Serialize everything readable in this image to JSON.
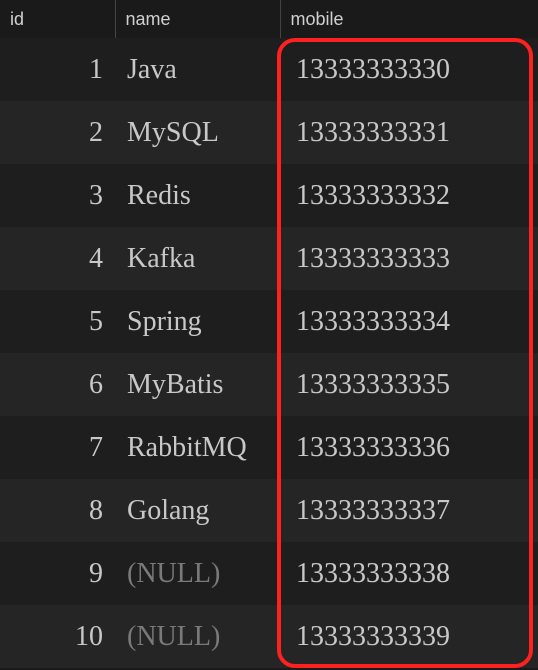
{
  "chart_data": {
    "type": "table",
    "columns": [
      "id",
      "name",
      "mobile"
    ],
    "rows": [
      {
        "id": 1,
        "name": "Java",
        "mobile": "13333333330"
      },
      {
        "id": 2,
        "name": "MySQL",
        "mobile": "13333333331"
      },
      {
        "id": 3,
        "name": "Redis",
        "mobile": "13333333332"
      },
      {
        "id": 4,
        "name": "Kafka",
        "mobile": "13333333333"
      },
      {
        "id": 5,
        "name": "Spring",
        "mobile": "13333333334"
      },
      {
        "id": 6,
        "name": "MyBatis",
        "mobile": "13333333335"
      },
      {
        "id": 7,
        "name": "RabbitMQ",
        "mobile": "13333333336"
      },
      {
        "id": 8,
        "name": "Golang",
        "mobile": "13333333337"
      },
      {
        "id": 9,
        "name": null,
        "mobile": "13333333338"
      },
      {
        "id": 10,
        "name": null,
        "mobile": "13333333339"
      }
    ],
    "highlighted_column": "mobile"
  },
  "headers": {
    "id": "id",
    "name": "name",
    "mobile": "mobile"
  },
  "rows": [
    {
      "id": "1",
      "name": "Java",
      "name_null": false,
      "mobile": "13333333330"
    },
    {
      "id": "2",
      "name": "MySQL",
      "name_null": false,
      "mobile": "13333333331"
    },
    {
      "id": "3",
      "name": "Redis",
      "name_null": false,
      "mobile": "13333333332"
    },
    {
      "id": "4",
      "name": "Kafka",
      "name_null": false,
      "mobile": "13333333333"
    },
    {
      "id": "5",
      "name": "Spring",
      "name_null": false,
      "mobile": "13333333334"
    },
    {
      "id": "6",
      "name": "MyBatis",
      "name_null": false,
      "mobile": "13333333335"
    },
    {
      "id": "7",
      "name": "RabbitMQ",
      "name_null": false,
      "mobile": "13333333336"
    },
    {
      "id": "8",
      "name": "Golang",
      "name_null": false,
      "mobile": "13333333337"
    },
    {
      "id": "9",
      "name": "(NULL)",
      "name_null": true,
      "mobile": "13333333338"
    },
    {
      "id": "10",
      "name": "(NULL)",
      "name_null": true,
      "mobile": "13333333339"
    }
  ]
}
